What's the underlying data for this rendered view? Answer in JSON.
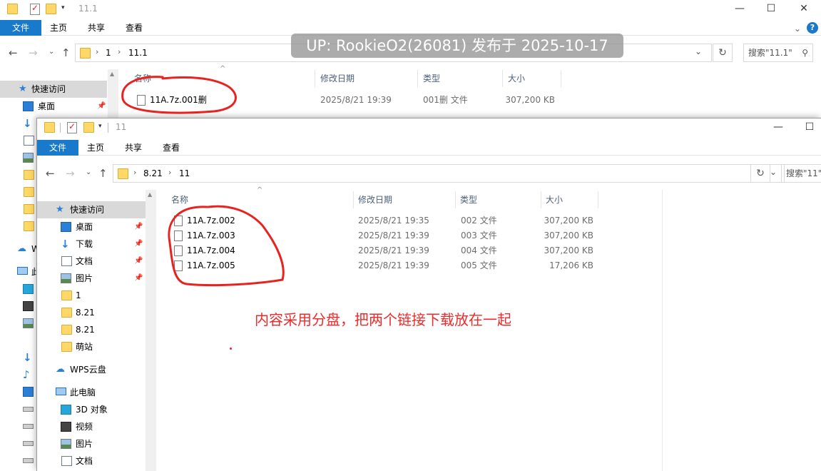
{
  "back_window": {
    "title": "11.1",
    "ribbon_tabs": [
      "文件",
      "主页",
      "共享",
      "查看"
    ],
    "address": [
      "1",
      "11.1"
    ],
    "search_placeholder": "搜索\"11.1\"",
    "columns": [
      "名称",
      "修改日期",
      "类型",
      "大小"
    ],
    "files": [
      {
        "name": "11A.7z.001删",
        "date": "2025/8/21 19:39",
        "type": "001删 文件",
        "size": "307,200 KB"
      }
    ],
    "nav": {
      "quick_access": "快速访问",
      "desktop": "桌面",
      "wps_partial": "W",
      "this_pc_partial": "此"
    }
  },
  "front_window": {
    "title": "11",
    "ribbon_tabs": [
      "文件",
      "主页",
      "共享",
      "查看"
    ],
    "address": [
      "8.21",
      "11"
    ],
    "search_placeholder": "搜索\"11\"",
    "columns": [
      "名称",
      "修改日期",
      "类型",
      "大小"
    ],
    "files": [
      {
        "name": "11A.7z.002",
        "date": "2025/8/21 19:35",
        "type": "002 文件",
        "size": "307,200 KB"
      },
      {
        "name": "11A.7z.003",
        "date": "2025/8/21 19:39",
        "type": "003 文件",
        "size": "307,200 KB"
      },
      {
        "name": "11A.7z.004",
        "date": "2025/8/21 19:39",
        "type": "004 文件",
        "size": "307,200 KB"
      },
      {
        "name": "11A.7z.005",
        "date": "2025/8/21 19:39",
        "type": "005 文件",
        "size": "17,206 KB"
      }
    ],
    "nav": {
      "quick_access": "快速访问",
      "desktop": "桌面",
      "downloads": "下载",
      "documents": "文档",
      "pictures": "图片",
      "folder_1": "1",
      "folder_821a": "8.21",
      "folder_821b": "8.21",
      "folder_site": "萌站",
      "wps_cloud": "WPS云盘",
      "this_pc": "此电脑",
      "objects_3d": "3D 对象",
      "videos": "视频",
      "pc_pictures": "图片",
      "pc_documents": "文档"
    }
  },
  "overlay": {
    "watermark": "UP: RookieO2(26081) 发布于 2025-10-17",
    "note": "内容采用分盘，把两个链接下载放在一起"
  },
  "colors": {
    "ribbon_file_tab": "#1979ca",
    "annotation_red": "#ee2b2b",
    "selected_nav": "#d9d9d9"
  }
}
